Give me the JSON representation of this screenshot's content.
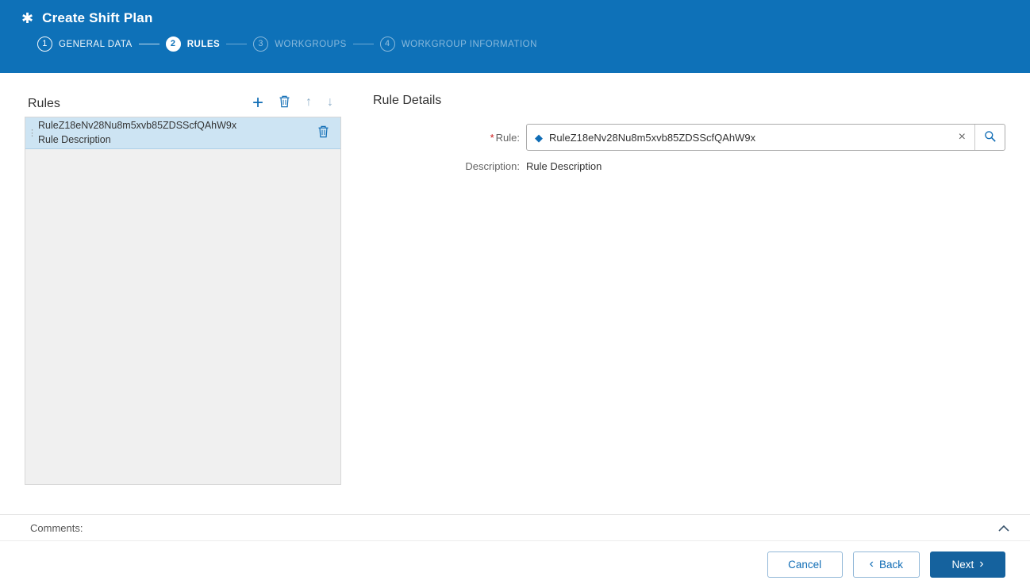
{
  "header": {
    "title": "Create Shift Plan",
    "icon_glyph": "✱"
  },
  "wizard": {
    "steps": [
      {
        "number": "1",
        "label": "GENERAL DATA",
        "state": "done"
      },
      {
        "number": "2",
        "label": "RULES",
        "state": "active"
      },
      {
        "number": "3",
        "label": "WORKGROUPS",
        "state": "todo"
      },
      {
        "number": "4",
        "label": "WORKGROUP INFORMATION",
        "state": "todo"
      }
    ]
  },
  "rules_panel": {
    "title": "Rules",
    "toolbar": {
      "add_glyph": "+",
      "up_glyph": "↑",
      "down_glyph": "↓"
    },
    "items": [
      {
        "name": "RuleZ18eNv28Nu8m5xvb85ZDSScfQAhW9x",
        "description": "Rule Description",
        "grip_glyph": "⋮",
        "selected": true
      }
    ]
  },
  "details_panel": {
    "title": "Rule Details",
    "required_marker": "*",
    "rule_label": "Rule:",
    "rule_value": "RuleZ18eNv28Nu8m5xvb85ZDSScfQAhW9x",
    "rule_icon_glyph": "◆",
    "clear_glyph": "×",
    "description_label": "Description:",
    "description_value": "Rule Description"
  },
  "comments": {
    "label": "Comments:"
  },
  "footer": {
    "cancel_label": "Cancel",
    "back_chevron": "‹",
    "back_label": "Back",
    "next_label": "Next",
    "next_chevron": "›"
  },
  "colors": {
    "header_bg": "#0e71b8",
    "accent": "#0f6cb5",
    "selected_row_bg": "#cde4f3",
    "next_button_bg": "#15629e"
  }
}
